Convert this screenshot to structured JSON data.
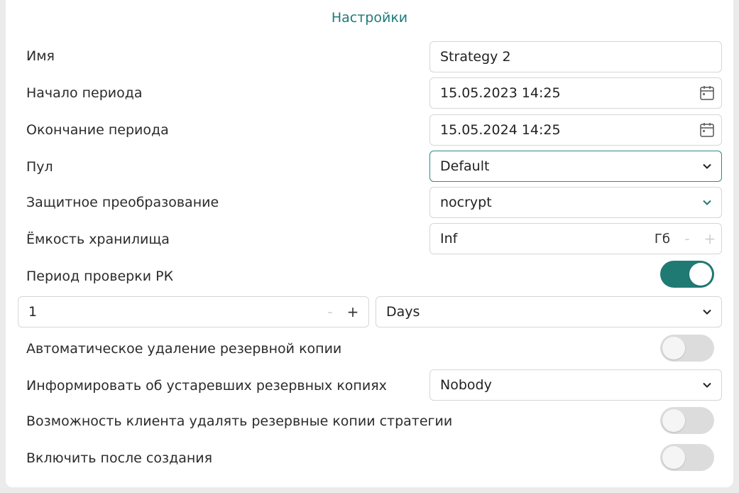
{
  "title": "Настройки",
  "fields": {
    "name": {
      "label": "Имя",
      "value": "Strategy 2"
    },
    "period_start": {
      "label": "Начало периода",
      "value": "15.05.2023 14:25"
    },
    "period_end": {
      "label": "Окончание периода",
      "value": "15.05.2024 14:25"
    },
    "pool": {
      "label": "Пул",
      "value": "Default"
    },
    "protection": {
      "label": "Защитное преобразование",
      "value": "nocrypt"
    },
    "capacity": {
      "label": "Ёмкость хранилища",
      "value": "Inf",
      "unit": "Гб",
      "minus": "-",
      "plus": "+"
    },
    "check_period": {
      "label": "Период проверки РК",
      "enabled": true,
      "count": "1",
      "minus": "-",
      "plus": "+",
      "unit_value": "Days"
    },
    "auto_delete": {
      "label": "Автоматическое удаление резервной копии",
      "enabled": false
    },
    "notify": {
      "label": "Информировать об устаревших резервных копиях",
      "value": "Nobody"
    },
    "client_delete": {
      "label": "Возможность клиента удалять резервные копии стратегии",
      "enabled": false
    },
    "enable_after": {
      "label": "Включить после создания",
      "enabled": false
    }
  },
  "icons": {
    "calendar": "calendar-icon",
    "chevron": "chevron-down-icon"
  },
  "colors": {
    "accent": "#1f7a74",
    "title": "#1e7a7a",
    "toggle_off": "#dcdcdc"
  }
}
